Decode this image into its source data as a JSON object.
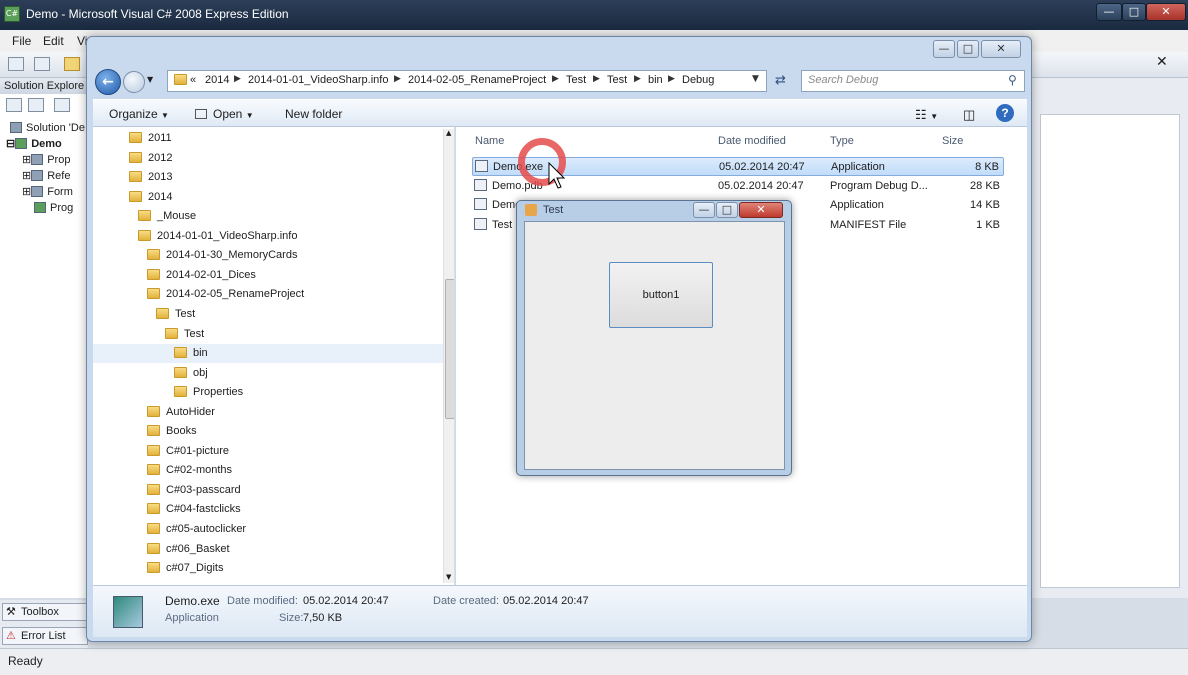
{
  "vs": {
    "title": "Demo - Microsoft Visual C# 2008 Express Edition",
    "menu": [
      "File",
      "Edit",
      "Vi"
    ],
    "solution_panel": {
      "header": "Solution Explore",
      "items": [
        "Solution 'De",
        "Demo",
        "Prop",
        "Refe",
        "Form",
        "Prog"
      ]
    },
    "bottom_tabs": [
      "Toolbox",
      "Error List"
    ],
    "status": "Ready"
  },
  "explorer": {
    "breadcrumb": [
      "2014",
      "2014-01-01_VideoSharp.info",
      "2014-02-05_RenameProject",
      "Test",
      "Test",
      "bin",
      "Debug"
    ],
    "search_placeholder": "Search Debug",
    "commands": {
      "organize": "Organize",
      "open": "Open",
      "new_folder": "New folder"
    },
    "tree": [
      {
        "label": "2011",
        "indent": 0
      },
      {
        "label": "2012",
        "indent": 0
      },
      {
        "label": "2013",
        "indent": 0
      },
      {
        "label": "2014",
        "indent": 0
      },
      {
        "label": "_Mouse",
        "indent": 1
      },
      {
        "label": "2014-01-01_VideoSharp.info",
        "indent": 1
      },
      {
        "label": "2014-01-30_MemoryCards",
        "indent": 2
      },
      {
        "label": "2014-02-01_Dices",
        "indent": 2
      },
      {
        "label": "2014-02-05_RenameProject",
        "indent": 2
      },
      {
        "label": "Test",
        "indent": 3
      },
      {
        "label": "Test",
        "indent": 4
      },
      {
        "label": "bin",
        "indent": 5
      },
      {
        "label": "obj",
        "indent": 5
      },
      {
        "label": "Properties",
        "indent": 5
      },
      {
        "label": "AutoHider",
        "indent": 2
      },
      {
        "label": "Books",
        "indent": 2
      },
      {
        "label": "C#01-picture",
        "indent": 2
      },
      {
        "label": "C#02-months",
        "indent": 2
      },
      {
        "label": "C#03-passcard",
        "indent": 2
      },
      {
        "label": "C#04-fastclicks",
        "indent": 2
      },
      {
        "label": "c#05-autoclicker",
        "indent": 2
      },
      {
        "label": "c#06_Basket",
        "indent": 2
      },
      {
        "label": "c#07_Digits",
        "indent": 2
      }
    ],
    "columns": {
      "name": "Name",
      "date": "Date modified",
      "type": "Type",
      "size": "Size"
    },
    "files": [
      {
        "name": "Demo.exe",
        "date": "05.02.2014 20:47",
        "type": "Application",
        "size": "8 KB"
      },
      {
        "name": "Demo.pdb",
        "date": "05.02.2014 20:47",
        "type": "Program Debug D...",
        "size": "28 KB"
      },
      {
        "name": "Demo",
        "date": "",
        "type": "Application",
        "size": "14 KB"
      },
      {
        "name": "Test",
        "date": "",
        "type": "MANIFEST File",
        "size": "1 KB"
      }
    ],
    "details": {
      "name": "Demo.exe",
      "kind": "Application",
      "modified_label": "Date modified:",
      "modified": "05.02.2014 20:47",
      "size_label": "Size:",
      "size": "7,50 KB",
      "created_label": "Date created:",
      "created": "05.02.2014 20:47"
    }
  },
  "form": {
    "title": "Test",
    "button": "button1"
  }
}
